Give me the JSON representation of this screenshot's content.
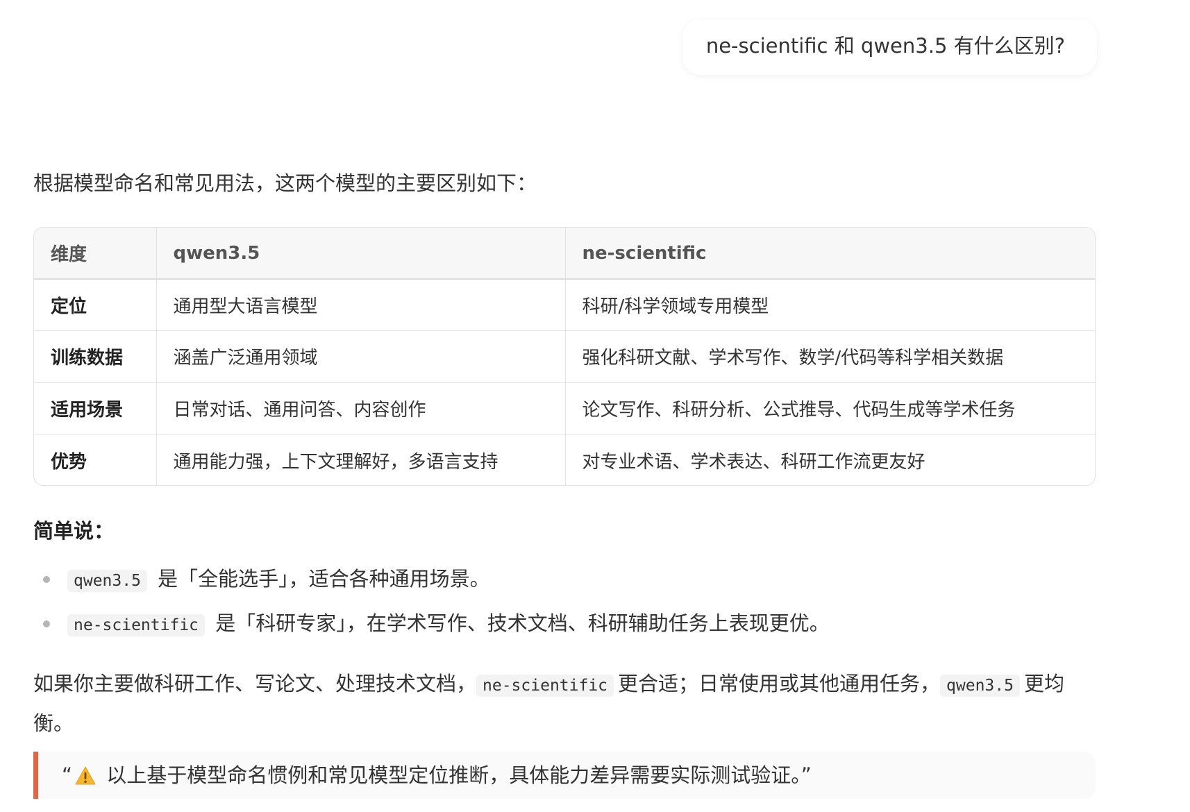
{
  "user_message": "ne-scientific 和 qwen3.5 有什么区别?",
  "answer": {
    "intro": "根据模型命名和常见用法，这两个模型的主要区别如下：",
    "table": {
      "headers": [
        "维度",
        "qwen3.5",
        "ne-scientific"
      ],
      "rows": [
        [
          "定位",
          "通用型大语言模型",
          "科研/科学领域专用模型"
        ],
        [
          "训练数据",
          "涵盖广泛通用领域",
          "强化科研文献、学术写作、数学/代码等科学相关数据"
        ],
        [
          "适用场景",
          "日常对话、通用问答、内容创作",
          "论文写作、科研分析、公式推导、代码生成等学术任务"
        ],
        [
          "优势",
          "通用能力强，上下文理解好，多语言支持",
          "对专业术语、学术表达、科研工作流更友好"
        ]
      ]
    },
    "summary_title": "简单说：",
    "bullets": [
      {
        "code": "qwen3.5",
        "text": "是「全能选手」，适合各种通用场景。"
      },
      {
        "code": "ne-scientific",
        "text": "是「科研专家」，在学术写作、技术文档、科研辅助任务上表现更优。"
      }
    ],
    "paragraph": {
      "part1": "如果你主要做科研工作、写论文、处理技术文档，",
      "code1": "ne-scientific",
      "part2": "更合适；日常使用或其他通用任务，",
      "code2": "qwen3.5",
      "part3": "更均衡。"
    },
    "quote": {
      "open_mark": "“",
      "icon": "warning-icon",
      "text": "以上基于模型命名惯例和常见模型定位推断，具体能力差异需要实际测试验证。",
      "close_mark": "”"
    }
  },
  "colors": {
    "quote_border": "#d9694a",
    "warning_fill": "#f5b731"
  }
}
